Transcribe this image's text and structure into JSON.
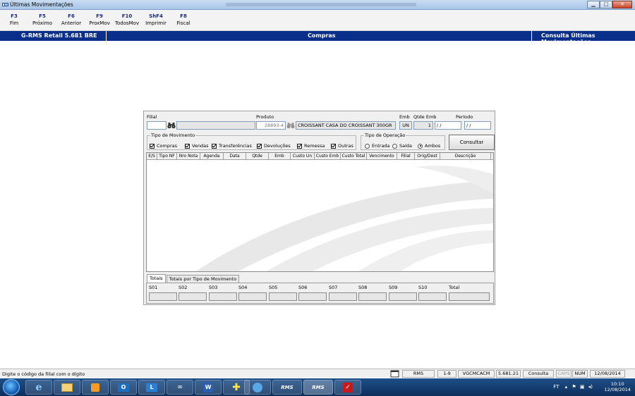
{
  "window": {
    "title": "Últimas Movimentações",
    "minimize_glyph": "▁",
    "maximize_glyph": "□",
    "close_glyph": "✕"
  },
  "toolbar": {
    "keys": [
      {
        "key": "F3",
        "label": "Fim"
      },
      {
        "key": "F5",
        "label": "Próximo"
      },
      {
        "key": "F6",
        "label": "Anterior"
      },
      {
        "key": "F9",
        "label": "ProxMov"
      },
      {
        "key": "F10",
        "label": "TodosMov"
      },
      {
        "key": "ShF4",
        "label": "Imprimir"
      },
      {
        "key": "F8",
        "label": "Fiscal"
      }
    ]
  },
  "header_strip": {
    "left": "G-RMS Retail 5.681 BRE",
    "center": "Compras",
    "right": "Consulta Últimas Movimentações",
    "color": "#0a2f8a"
  },
  "form": {
    "filial_label": "Filial",
    "filial_value": "",
    "produto_label": "Produto",
    "produto_code": "28893-4",
    "produto_desc": "CROISSANT CASA DO CROISSANT 300GR",
    "emb_label": "Emb",
    "emb_value": "UN",
    "qtde_emb_label": "Qtde Emb",
    "qtde_emb_value": "1",
    "periodo_label": "Período",
    "periodo_from": " / /",
    "periodo_to": " / /"
  },
  "tipo_movimento": {
    "title": "Tipo de Movimento",
    "options": [
      {
        "label": "Compras",
        "checked": true
      },
      {
        "label": "Vendas",
        "checked": true
      },
      {
        "label": "Transferências",
        "checked": true
      },
      {
        "label": "Devoluções",
        "checked": true
      },
      {
        "label": "Remessa",
        "checked": true
      },
      {
        "label": "Outras",
        "checked": true
      }
    ]
  },
  "tipo_operacao": {
    "title": "Tipo de Operação",
    "options": [
      {
        "label": "Entrada",
        "selected": false
      },
      {
        "label": "Saída",
        "selected": false
      },
      {
        "label": "Ambos",
        "selected": true
      }
    ]
  },
  "consultar_label": "Consultar",
  "grid": {
    "columns": [
      "E/S",
      "Tipo NF",
      "Nro Nota",
      "Agenda",
      "Data",
      "Qtde",
      "Emb",
      "Custo Un",
      "Custo Emb",
      "Custo Total",
      "Vencimento",
      "Filial",
      "Orig/Dest",
      "Descrição"
    ],
    "rows": []
  },
  "tabs": [
    "Totais",
    "Totais por Tipo de Movimento"
  ],
  "totais": {
    "columns": [
      "S01",
      "S02",
      "S03",
      "S04",
      "S05",
      "S06",
      "S07",
      "S08",
      "S09",
      "S10",
      "Total"
    ]
  },
  "status": {
    "message": "Digite o código da filial com o dígito",
    "cells": [
      "RMS",
      "1-9",
      "VGCMCACM",
      "5.681.21",
      "Consulta",
      "CAPS",
      "NUM",
      "12/08/2014"
    ]
  },
  "taskbar": {
    "apps": [
      "IE",
      "Explorer",
      "Media",
      "Outlook",
      "Lync",
      "Connect",
      "Word",
      "Calc",
      "Remote",
      "RMS",
      "RMS",
      "PDF"
    ],
    "rms_label": "RMS",
    "tray_lang": "FT",
    "time": "10:10",
    "date": "12/08/2014"
  }
}
